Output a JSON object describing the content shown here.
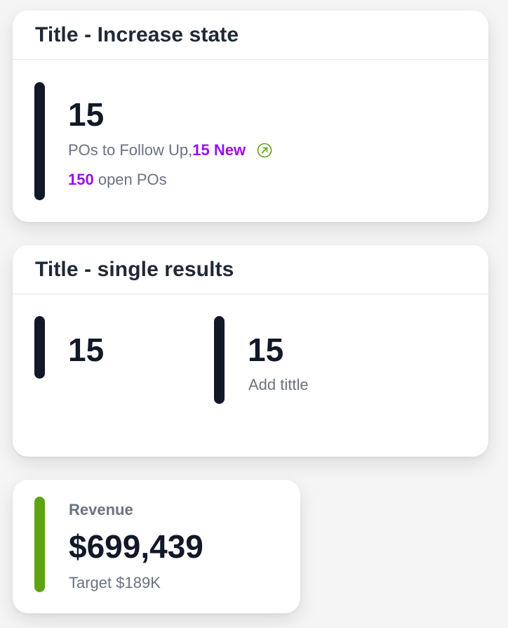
{
  "card_increase": {
    "title": "Title - Increase state",
    "value": "15",
    "follow_up_text": "POs to Follow Up,",
    "new_highlight": "15 New",
    "open_count": "150",
    "open_text": " open POs",
    "trend_icon": "arrow-up-right-circle-icon",
    "accent_color": "#111827",
    "highlight_color": "#9810ee",
    "trend_color": "#5fa314"
  },
  "card_single": {
    "title": "Title - single results",
    "left_value": "15",
    "right_value": "15",
    "right_subtitle": "Add tittle",
    "accent_color": "#111827"
  },
  "card_revenue": {
    "label": "Revenue",
    "value": "$699,439",
    "target": "Target $189K",
    "accent_color": "#5fa314"
  }
}
